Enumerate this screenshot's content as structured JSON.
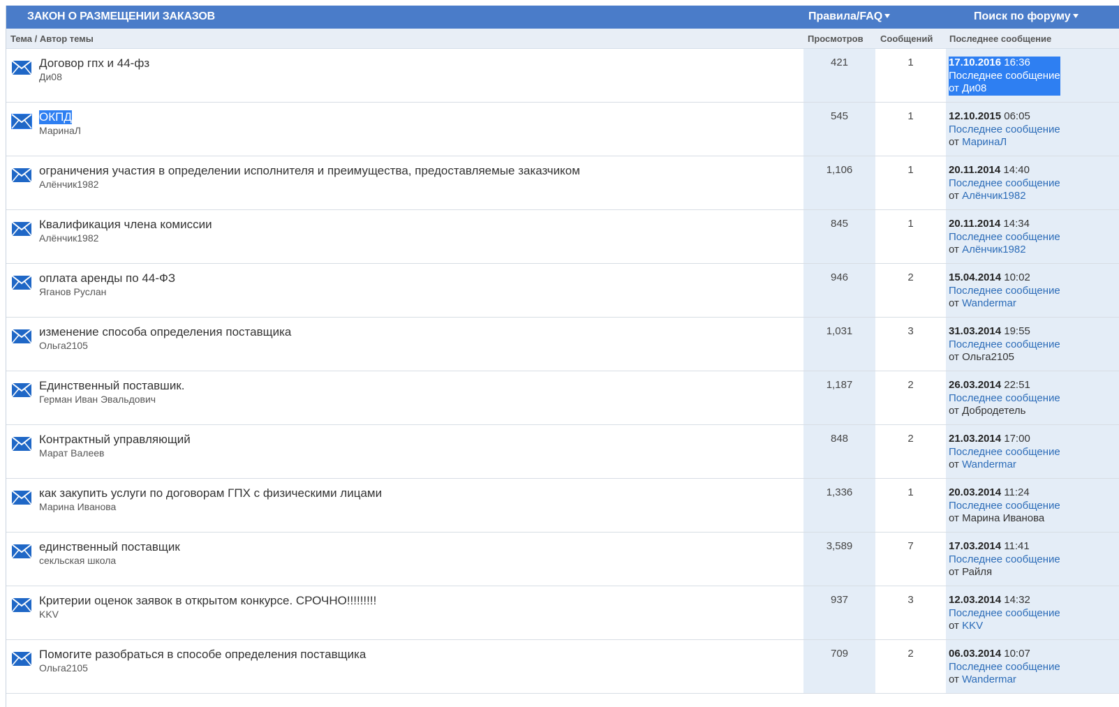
{
  "header": {
    "title": "ЗАКОН О РАЗМЕЩЕНИИ ЗАКАЗОВ",
    "rules": "Правила/FAQ",
    "search": "Поиск по форуму"
  },
  "columns": {
    "topic": "Тема / Автор темы",
    "views": "Просмотров",
    "posts": "Сообщений",
    "last": "Последнее сообщение"
  },
  "labels": {
    "last_message": "Последнее сообщение",
    "from": "от"
  },
  "topics": [
    {
      "title": "Договор гпх и 44-фз",
      "author": "Ди08",
      "views": "421",
      "posts": "1",
      "date": "17.10.2016",
      "time": "16:36",
      "last_author": "Ди08",
      "author_link": true
    },
    {
      "title": "ОКПД",
      "author": "МаринаЛ",
      "views": "545",
      "posts": "1",
      "date": "12.10.2015",
      "time": "06:05",
      "last_author": "МаринаЛ",
      "author_link": true
    },
    {
      "title": "ограничения участия в определении исполнителя и преимущества, предоставляемые заказчиком",
      "author": "Алёнчик1982",
      "views": "1,106",
      "posts": "1",
      "date": "20.11.2014",
      "time": "14:40",
      "last_author": "Алёнчик1982",
      "author_link": true
    },
    {
      "title": "Квалификация члена комиссии",
      "author": "Алёнчик1982",
      "views": "845",
      "posts": "1",
      "date": "20.11.2014",
      "time": "14:34",
      "last_author": "Алёнчик1982",
      "author_link": true
    },
    {
      "title": "оплата аренды по 44-ФЗ",
      "author": "Яганов Руслан",
      "views": "946",
      "posts": "2",
      "date": "15.04.2014",
      "time": "10:02",
      "last_author": "Wandermar",
      "author_link": true
    },
    {
      "title": "изменение способа определения поставщика",
      "author": "Ольга2105",
      "views": "1,031",
      "posts": "3",
      "date": "31.03.2014",
      "time": "19:55",
      "last_author": "Ольга2105",
      "author_link": false
    },
    {
      "title": "Единственный поставшик.",
      "author": "Герман Иван Эвальдович",
      "views": "1,187",
      "posts": "2",
      "date": "26.03.2014",
      "time": "22:51",
      "last_author": "Добродетель",
      "author_link": false
    },
    {
      "title": "Контрактный управляющий",
      "author": "Марат Валеев",
      "views": "848",
      "posts": "2",
      "date": "21.03.2014",
      "time": "17:00",
      "last_author": "Wandermar",
      "author_link": true
    },
    {
      "title": "как закупить услуги по договорам ГПХ с физическими лицами",
      "author": "Марина Иванова",
      "views": "1,336",
      "posts": "1",
      "date": "20.03.2014",
      "time": "11:24",
      "last_author": "Марина Иванова",
      "author_link": false
    },
    {
      "title": "единственный поставщик",
      "author": "секльская школа",
      "views": "3,589",
      "posts": "7",
      "date": "17.03.2014",
      "time": "11:41",
      "last_author": "Райля",
      "author_link": false
    },
    {
      "title": "Критерии оценок заявок в открытом конкурсе. СРОЧНО!!!!!!!!!",
      "author": "KKV",
      "views": "937",
      "posts": "3",
      "date": "12.03.2014",
      "time": "14:32",
      "last_author": "KKV",
      "author_link": true
    },
    {
      "title": "Помогите разобраться в способе определения поставщика",
      "author": "Ольга2105",
      "views": "709",
      "posts": "2",
      "date": "06.03.2014",
      "time": "10:07",
      "last_author": "Wandermar",
      "author_link": true
    }
  ]
}
